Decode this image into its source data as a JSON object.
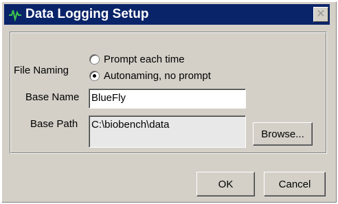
{
  "window": {
    "title": "Data Logging Setup",
    "app_icon": "waveform-icon",
    "close_icon": "close-icon",
    "close_glyph": "✕"
  },
  "file_naming": {
    "label": "File Naming",
    "options": [
      {
        "label": "Prompt each time",
        "checked": false
      },
      {
        "label": "Autonaming, no prompt",
        "checked": true
      }
    ]
  },
  "base_name": {
    "label": "Base Name",
    "value": "BlueFly"
  },
  "base_path": {
    "label": "Base Path",
    "value": "C:\\biobench\\data"
  },
  "buttons": {
    "browse": "Browse...",
    "ok": "OK",
    "cancel": "Cancel"
  },
  "colors": {
    "title_bar": "#0a246a",
    "dialog_face": "#d4d0c8"
  }
}
